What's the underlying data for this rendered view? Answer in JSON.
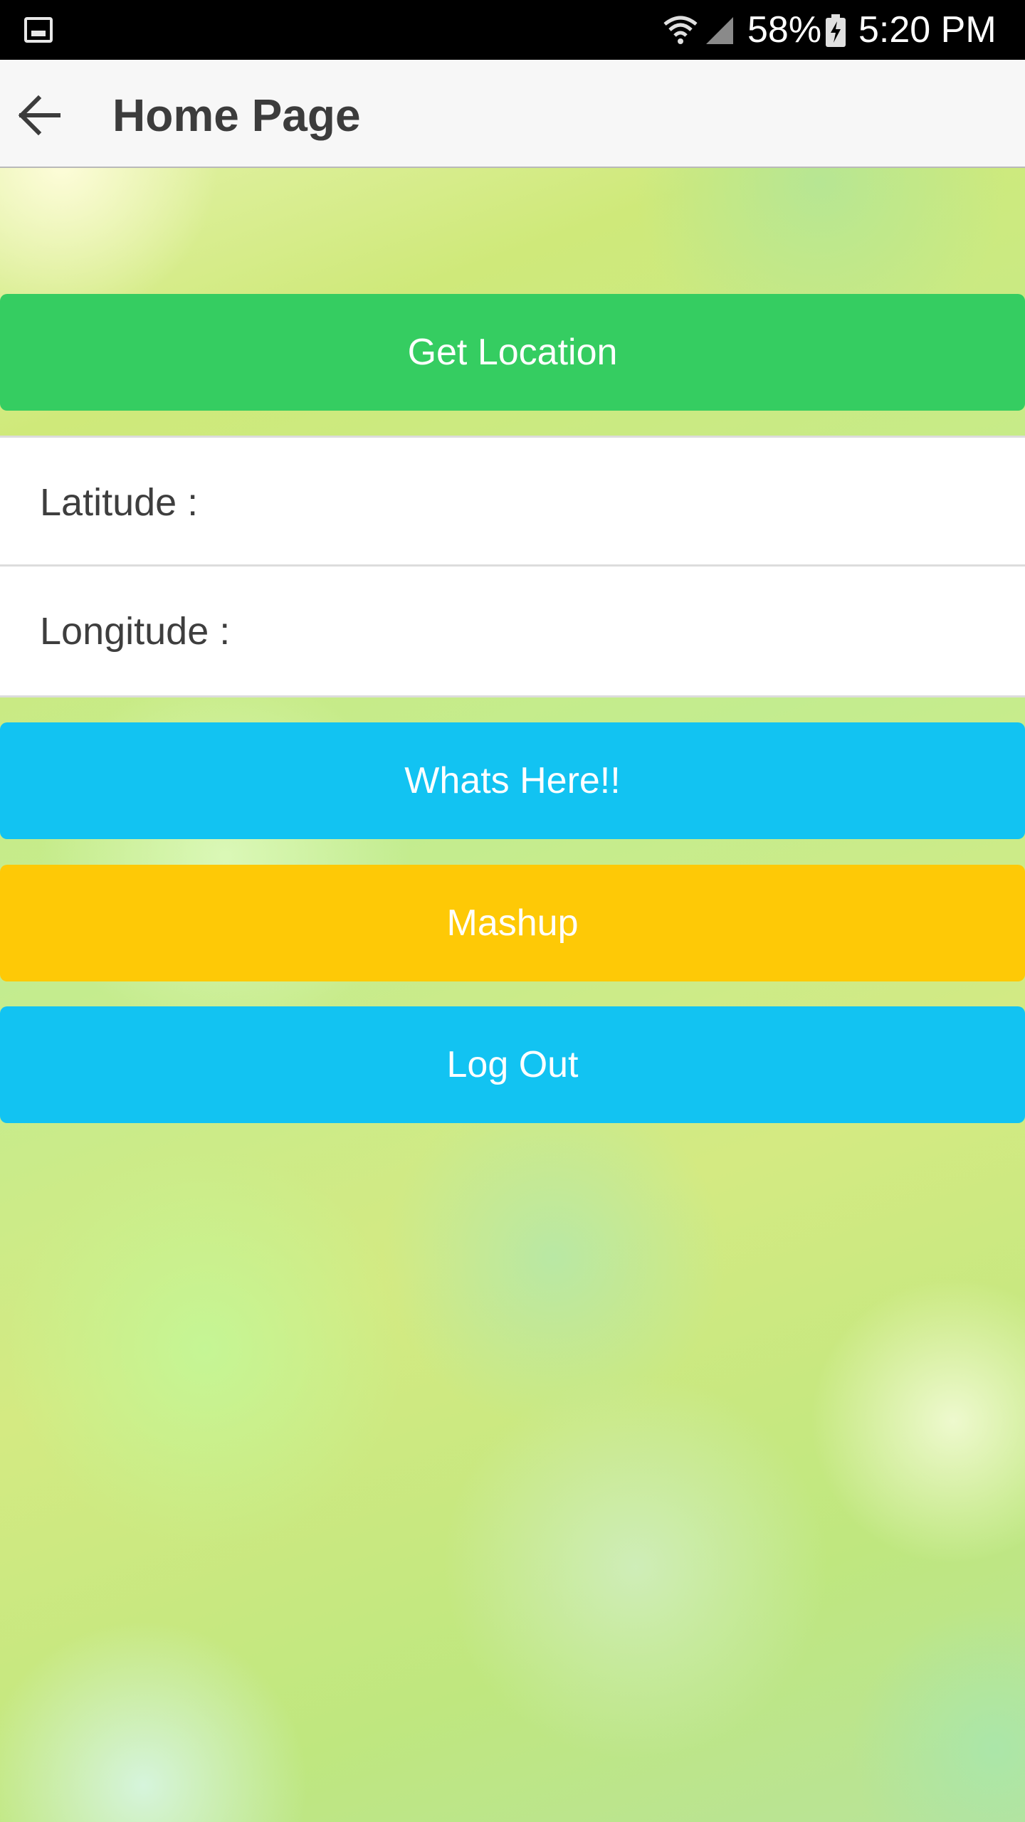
{
  "status_bar": {
    "battery": "58%",
    "time": "5:20 PM",
    "icons": [
      "image-notification-icon",
      "wifi-icon",
      "signal-icon",
      "battery-charging-icon"
    ]
  },
  "app_bar": {
    "back_icon": "arrow-back-icon",
    "title": "Home Page"
  },
  "buttons": {
    "get_location": "Get Location",
    "whats_here": "Whats Here!!",
    "mashup": "Mashup",
    "logout": "Log Out"
  },
  "fields": {
    "latitude_label": "Latitude :",
    "latitude_value": "",
    "longitude_label": "Longitude :",
    "longitude_value": ""
  },
  "colors": {
    "get_location": "#35cd61",
    "whats_here": "#12c3f2",
    "mashup": "#fec906",
    "logout": "#12c3f2"
  }
}
